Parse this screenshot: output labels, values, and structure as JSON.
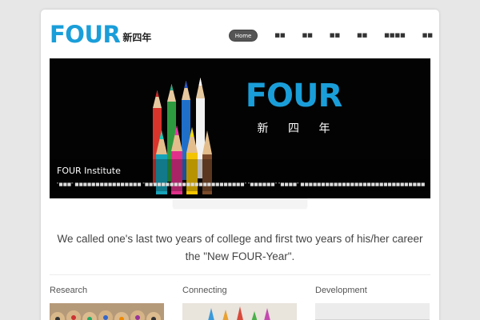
{
  "header": {
    "logo_word": "FOUR",
    "logo_cjk": "新四年"
  },
  "nav": {
    "items": [
      "Home",
      "■■",
      "■■",
      "■■",
      "■■",
      "■■■■",
      "■■"
    ]
  },
  "slider": {
    "brand_word": "FOUR",
    "brand_cjk": "新 四 年",
    "caption_title": "FOUR Institute",
    "caption_text": "\"■■■\" ■■■■■■■■■■■■■■■■ \"■■■■■■■■■■■■■■■■■■■■■■■■\" \"■■■■■■\" \"■■■■\" ■■■■■■■■■■■■■■■■■■■■■■■■■■■■■■■■■■■■■■■■■■■■■■■■■■■■■■■■■■■■■■■■■■■■■■■■"
  },
  "tagline": {
    "line1": "We called one's last two years of college and first two years of his/her career",
    "line2": "the \"New FOUR-Year\"."
  },
  "columns": [
    {
      "title": "Research"
    },
    {
      "title": "Connecting"
    },
    {
      "title": "Development"
    }
  ],
  "colors": {
    "brand": "#1a9ed9",
    "slider_bg": "#030303",
    "nav_active": "#555555"
  }
}
